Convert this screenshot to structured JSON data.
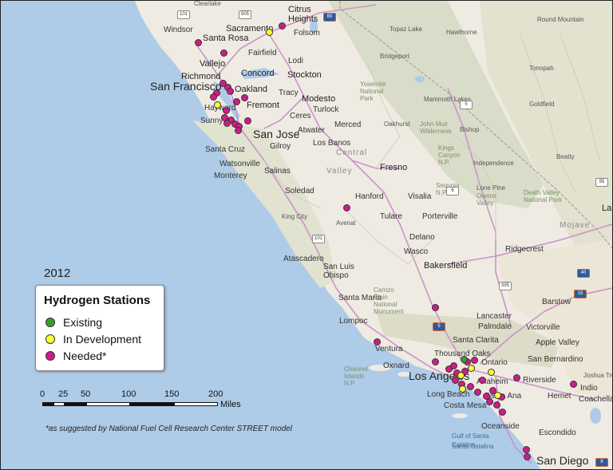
{
  "map": {
    "year": "2012",
    "legend": {
      "title": "Hydrogen Stations",
      "items": [
        {
          "label": "Existing",
          "color": "#33a02c"
        },
        {
          "label": "In Development",
          "color": "#ffff33"
        },
        {
          "label": "Needed*",
          "color": "#d01c8b"
        }
      ]
    },
    "scale": {
      "ticks": [
        "0",
        "25",
        "50",
        "100",
        "150",
        "200"
      ],
      "units": "Miles"
    },
    "footnote": "*as suggested by National Fuel Cell Research Center STREET model",
    "colors": {
      "ocean": "#aecbe7",
      "land": "#efebe2",
      "mountain": "#d6d9c4",
      "freeway": "#c994c7"
    },
    "places": {
      "clearlake": "Clearlake",
      "windsor": "Windsor",
      "santa_rosa": "Santa Rosa",
      "sacramento": "Sacramento",
      "citrus_heights": "Citrus Heights",
      "folsom": "Folsom",
      "fairfield": "Fairfield",
      "vallejo": "Vallejo",
      "lodi": "Lodi",
      "richmond": "Richmond",
      "concord": "Concord",
      "stockton": "Stockton",
      "san_francisco": "San Francisco",
      "oakland": "Oakland",
      "tracy": "Tracy",
      "modesto": "Modesto",
      "hayward": "Hayward",
      "fremont": "Fremont",
      "turlock": "Turlock",
      "ceres": "Ceres",
      "sunnyvale": "Sunny",
      "san_jose": "San Jose",
      "atwater": "Atwater",
      "merced": "Merced",
      "los_banos": "Los Banos",
      "santa_cruz": "Santa Cruz",
      "gilroy": "Gilroy",
      "watsonville": "Watsonville",
      "monterey": "Monterey",
      "salinas": "Salinas",
      "fresno": "Fresno",
      "soledad": "Soledad",
      "hanford": "Hanford",
      "visalia": "Visalia",
      "king_city": "King City",
      "avenal": "Avenal",
      "tulare": "Tulare",
      "porterville": "Porterville",
      "delano": "Delano",
      "wasco": "Wasco",
      "atascadero": "Atascadero",
      "san_luis_obispo": "San Luis Obispo",
      "bakersfield": "Bakersfield",
      "santa_maria": "Santa Maria",
      "lompoc": "Lompoc",
      "lancaster": "Lancaster",
      "palmdale": "Palmdale",
      "santa_clarita": "Santa Clarita",
      "victorville": "Victorville",
      "apple_valley": "Apple Valley",
      "barstow": "Barstow",
      "ventura": "Ventura",
      "thousand_oaks": "Thousand Oaks",
      "oxnard": "Oxnard",
      "los_angeles": "Los Angeles",
      "ontario": "Ontario",
      "san_bernardino": "San Bernardino",
      "riverside": "Riverside",
      "anaheim": "Anaheim",
      "long_beach": "Long Beach",
      "santa_ana": "Santa Ana",
      "costa_mesa": "Costa Mesa",
      "hemet": "Hemet",
      "oceanside": "Oceanside",
      "escondido": "Escondido",
      "san_diego": "San Diego",
      "indio": "Indio",
      "coachella": "Coachella",
      "joshua_tree": "Joshua Tre",
      "ridgecrest": "Ridgecrest",
      "bishop": "Bishop",
      "independence": "Independence",
      "lone_pine": "Lone Pine",
      "beatty": "Beatty",
      "tonopah": "Tonopah",
      "goldfield": "Goldfield",
      "hawthorne": "Hawthorne",
      "round_mountain": "Round Mountain",
      "topaz_lake": "Topaz Lake",
      "bridgeport": "Bridgeport",
      "oakhurst": "Oakhurst",
      "mammoth_lakes": "Mammoth Lakes",
      "owens_valley": "Owens Valley",
      "central_valley_a": "Central",
      "central_valley_b": "Valley",
      "mojave": "Mojave",
      "yosemite": "Yosemite National Park",
      "john_muir": "John Muir Wilderness",
      "kings_canyon": "Kings Canyon N.P.",
      "sequoia": "Sequoia N.P.",
      "death_valley": "Death Valley National Park",
      "carrizo": "Carrizo Plain National Monument",
      "channel_islands": "Channel Islands N.P.",
      "gulf_santa_catalina": "Gulf of Santa Catalina",
      "catalina": "Santa Catalina",
      "la": "La"
    },
    "shields": [
      "101",
      "505",
      "80",
      "5",
      "101",
      "395",
      "95",
      "15",
      "40",
      "8",
      "5",
      "6"
    ]
  }
}
